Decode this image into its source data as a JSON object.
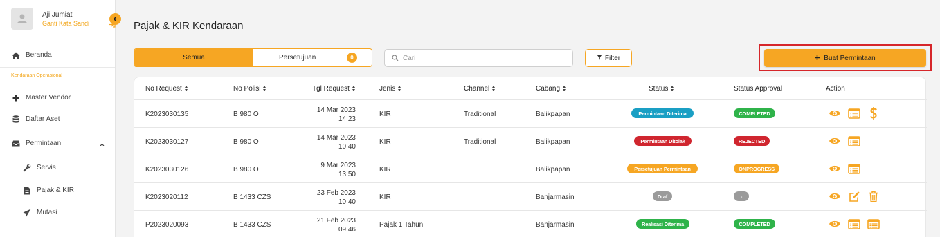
{
  "user": {
    "name": "Aji Jumiati",
    "change_password": "Ganti Kata Sandi"
  },
  "sidebar": {
    "home": "Beranda",
    "section": "Kendaraan Operasional",
    "items": [
      {
        "label": "Master Vendor",
        "icon": "plus-icon"
      },
      {
        "label": "Daftar Aset",
        "icon": "database-icon"
      },
      {
        "label": "Permintaan",
        "icon": "inbox-icon"
      }
    ],
    "sub_items": [
      {
        "label": "Servis",
        "icon": "wrench-icon"
      },
      {
        "label": "Pajak & KIR",
        "icon": "file-icon"
      },
      {
        "label": "Mutasi",
        "icon": "paper-plane-icon"
      }
    ]
  },
  "page": {
    "title": "Pajak & KIR Kendaraan"
  },
  "tabs": {
    "all": "Semua",
    "approval": "Persetujuan",
    "approval_count": "0"
  },
  "search": {
    "placeholder": "Cari"
  },
  "filter": {
    "label": "Filter"
  },
  "create": {
    "label": "Buat Permintaan"
  },
  "table": {
    "headers": [
      "No Request",
      "No Polisi",
      "Tgl Request",
      "Jenis",
      "Channel",
      "Cabang",
      "Status",
      "Status Approval",
      "Action"
    ],
    "rows": [
      {
        "no_request": "K2023030135",
        "no_polisi": "B 980 O",
        "date": "14 Mar 2023",
        "time": "14:23",
        "jenis": "KIR",
        "channel": "Traditional",
        "cabang": "Balikpapan",
        "status": "Permintaan Diterima",
        "status_color": "#1a9fc4",
        "approval": "COMPLETED",
        "approval_color": "#2fb34a",
        "actions": [
          "view",
          "list",
          "dollar"
        ]
      },
      {
        "no_request": "K2023030127",
        "no_polisi": "B 980 O",
        "date": "14 Mar 2023",
        "time": "10:40",
        "jenis": "KIR",
        "channel": "Traditional",
        "cabang": "Balikpapan",
        "status": "Permintaan Ditolak",
        "status_color": "#d0262f",
        "approval": "REJECTED",
        "approval_color": "#d0262f",
        "actions": [
          "view",
          "list"
        ]
      },
      {
        "no_request": "K2023030126",
        "no_polisi": "B 980 O",
        "date": "9 Mar 2023",
        "time": "13:50",
        "jenis": "KIR",
        "channel": "",
        "cabang": "Balikpapan",
        "status": "Persetujuan Permintaan",
        "status_color": "#f6a623",
        "approval": "ONPROGRESS",
        "approval_color": "#f6a623",
        "actions": [
          "view",
          "list"
        ]
      },
      {
        "no_request": "K2023020112",
        "no_polisi": "B 1433 CZS",
        "date": "23 Feb 2023",
        "time": "10:40",
        "jenis": "KIR",
        "channel": "",
        "cabang": "Banjarmasin",
        "status": "Draf",
        "status_color": "#9b9b9b",
        "approval": "-",
        "approval_color": "#9b9b9b",
        "actions": [
          "view",
          "edit",
          "trash"
        ]
      },
      {
        "no_request": "P2023020093",
        "no_polisi": "B 1433 CZS",
        "date": "21 Feb 2023",
        "time": "09:46",
        "jenis": "Pajak 1 Tahun",
        "channel": "",
        "cabang": "Banjarmasin",
        "status": "Realisasi Diterima",
        "status_color": "#2fb34a",
        "approval": "COMPLETED",
        "approval_color": "#2fb34a",
        "actions": [
          "view",
          "list",
          "list"
        ]
      }
    ]
  },
  "colors": {
    "accent": "#f6a623",
    "highlight": "#d6262a"
  }
}
